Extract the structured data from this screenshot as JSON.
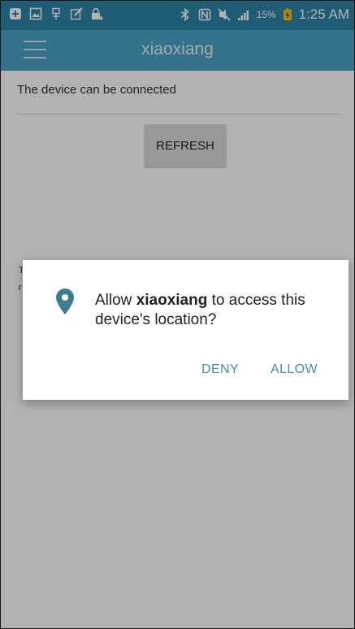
{
  "status_bar": {
    "battery_percent": "15%",
    "time": "1:25 AM",
    "icons": [
      "add-icon",
      "gallery-icon",
      "usb-icon",
      "edit-icon",
      "lock-icon",
      "bluetooth-icon",
      "nfc-icon",
      "silent-icon",
      "signal-icon",
      "battery-icon"
    ]
  },
  "app_bar": {
    "title": "xiaoxiang",
    "menu_icon": "menu-icon"
  },
  "content": {
    "device_label": "The device can be connected",
    "refresh_label": "REFRESH",
    "stray_1": "T",
    "stray_2": "r"
  },
  "dialog": {
    "prefix": "Allow ",
    "app_name": "xiaoxiang",
    "suffix": " to access this device's location?",
    "deny_label": "DENY",
    "allow_label": "ALLOW",
    "icon": "location-pin-icon"
  },
  "colors": {
    "status_bar": "#2b86a6",
    "app_bar": "#4aa4c6",
    "accent": "#4a8fa3",
    "scrim": "rgba(0,0,0,0.30)"
  }
}
